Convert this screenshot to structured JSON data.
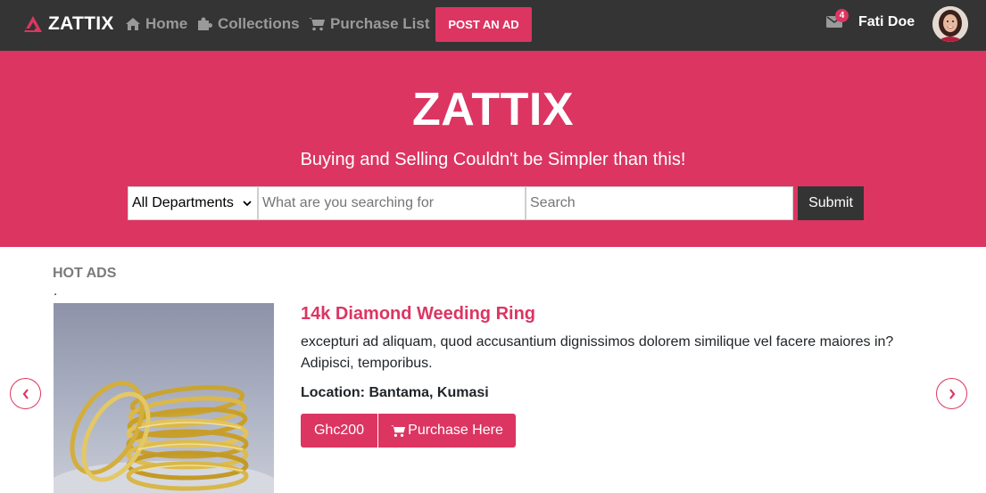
{
  "nav": {
    "brand": "ZATTIX",
    "links": [
      {
        "label": "Home",
        "icon": "home-icon"
      },
      {
        "label": "Collections",
        "icon": "puzzle-icon"
      },
      {
        "label": "Purchase List",
        "icon": "cart-icon"
      }
    ],
    "post_ad": "POST AN AD",
    "mail_count": "4",
    "user_name": "Fati Doe"
  },
  "hero": {
    "title": "ZATTIX",
    "subtitle": "Buying and Selling Couldn't be Simpler than this!",
    "department": "All Departments",
    "keyword_placeholder": "What are you searching for",
    "location_placeholder": "Search",
    "submit": "Submit"
  },
  "hot_ads": {
    "title": "HOT ADS",
    "dot": ".",
    "ad": {
      "title": "14k Diamond Weeding Ring",
      "description": "excepturi ad aliquam, quod accusantium dignissimos dolorem similique vel facere maiores in? Adipisci, temporibus.",
      "location": "Location: Bantama, Kumasi",
      "price": "Ghc200",
      "purchase": "Purchase Here"
    }
  },
  "colors": {
    "accent": "#dc3562",
    "navbar": "#343434"
  }
}
